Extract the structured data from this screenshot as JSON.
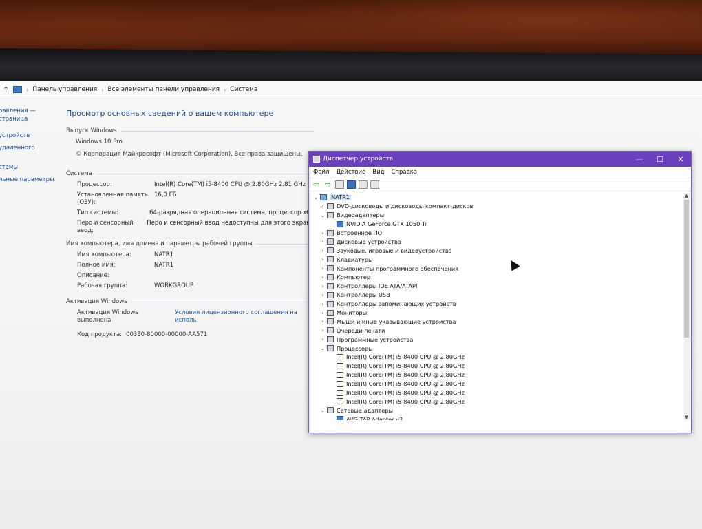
{
  "address_bar": {
    "crumbs": [
      "Панель управления",
      "Все элементы панели управления",
      "Система"
    ]
  },
  "leftnav": {
    "items": [
      "равления —",
      "страница",
      "устройств",
      "удаленного",
      "стемы",
      "льные параметры"
    ]
  },
  "system": {
    "page_title": "Просмотр основных сведений о вашем компьютере",
    "edition_head": "Выпуск Windows",
    "edition": "Windows 10 Pro",
    "copyright": "© Корпорация Майкрософт (Microsoft Corporation). Все права защищены.",
    "system_head": "Система",
    "rows": [
      {
        "k": "Процессор:",
        "v": "Intel(R) Core(TM) i5-8400 CPU @ 2.80GHz   2.81 GHz"
      },
      {
        "k": "Установленная память (ОЗУ):",
        "v": "16,0 ГБ"
      },
      {
        "k": "Тип системы:",
        "v": "64-разрядная операционная система, процессор x64"
      },
      {
        "k": "Перо и сенсорный ввод:",
        "v": "Перо и сенсорный ввод недоступны для этого экрана"
      }
    ],
    "name_head": "Имя компьютера, имя домена и параметры рабочей группы",
    "name_rows": [
      {
        "k": "Имя компьютера:",
        "v": "NATR1"
      },
      {
        "k": "Полное имя:",
        "v": "NATR1"
      },
      {
        "k": "Описание:",
        "v": ""
      },
      {
        "k": "Рабочая группа:",
        "v": "WORKGROUP"
      }
    ],
    "activation_head": "Активация Windows",
    "activation_status": "Активация Windows выполнена",
    "activation_link": "Условия лицензионного соглашения на исполь",
    "product_key_label": "Код продукта:",
    "product_key": "00330-80000-00000-AA571"
  },
  "device_manager": {
    "title": "Диспетчер устройств",
    "menu": [
      "Файл",
      "Действие",
      "Вид",
      "Справка"
    ],
    "window_buttons": [
      "—",
      "☐",
      "✕"
    ],
    "root": "NATR1",
    "tree": [
      {
        "label": "DVD-дисководы и дисководы компакт-дисков",
        "level": 1,
        "expand": "collapsed"
      },
      {
        "label": "Видеоадаптеры",
        "level": 1,
        "expand": "expanded"
      },
      {
        "label": "NVIDIA GeForce GTX 1050 Ti",
        "level": 2,
        "expand": "none"
      },
      {
        "label": "Встроенное ПО",
        "level": 1,
        "expand": "collapsed"
      },
      {
        "label": "Дисковые устройства",
        "level": 1,
        "expand": "collapsed"
      },
      {
        "label": "Звуковые, игровые и видеоустройства",
        "level": 1,
        "expand": "collapsed"
      },
      {
        "label": "Клавиатуры",
        "level": 1,
        "expand": "collapsed"
      },
      {
        "label": "Компоненты программного обеспечения",
        "level": 1,
        "expand": "collapsed"
      },
      {
        "label": "Компьютер",
        "level": 1,
        "expand": "collapsed"
      },
      {
        "label": "Контроллеры IDE ATA/ATAPI",
        "level": 1,
        "expand": "collapsed"
      },
      {
        "label": "Контроллеры USB",
        "level": 1,
        "expand": "collapsed"
      },
      {
        "label": "Контроллеры запоминающих устройств",
        "level": 1,
        "expand": "collapsed"
      },
      {
        "label": "Мониторы",
        "level": 1,
        "expand": "collapsed"
      },
      {
        "label": "Мыши и иные указывающие устройства",
        "level": 1,
        "expand": "collapsed"
      },
      {
        "label": "Очереди печати",
        "level": 1,
        "expand": "collapsed"
      },
      {
        "label": "Программные устройства",
        "level": 1,
        "expand": "collapsed"
      },
      {
        "label": "Процессоры",
        "level": 1,
        "expand": "expanded"
      },
      {
        "label": "Intel(R) Core(TM) i5-8400 CPU @ 2.80GHz",
        "level": 2,
        "expand": "none",
        "icon": "cpu"
      },
      {
        "label": "Intel(R) Core(TM) i5-8400 CPU @ 2.80GHz",
        "level": 2,
        "expand": "none",
        "icon": "cpu"
      },
      {
        "label": "Intel(R) Core(TM) i5-8400 CPU @ 2.80GHz",
        "level": 2,
        "expand": "none",
        "icon": "cpu"
      },
      {
        "label": "Intel(R) Core(TM) i5-8400 CPU @ 2.80GHz",
        "level": 2,
        "expand": "none",
        "icon": "cpu"
      },
      {
        "label": "Intel(R) Core(TM) i5-8400 CPU @ 2.80GHz",
        "level": 2,
        "expand": "none",
        "icon": "cpu"
      },
      {
        "label": "Intel(R) Core(TM) i5-8400 CPU @ 2.80GHz",
        "level": 2,
        "expand": "none",
        "icon": "cpu"
      },
      {
        "label": "Сетевые адаптеры",
        "level": 1,
        "expand": "expanded"
      },
      {
        "label": "AVG TAP Adapter v3",
        "level": 2,
        "expand": "none"
      }
    ]
  },
  "colors": {
    "dm_titlebar": "#6c3fc0",
    "link": "#1a5fb4",
    "title_blue": "#1e4e88"
  }
}
